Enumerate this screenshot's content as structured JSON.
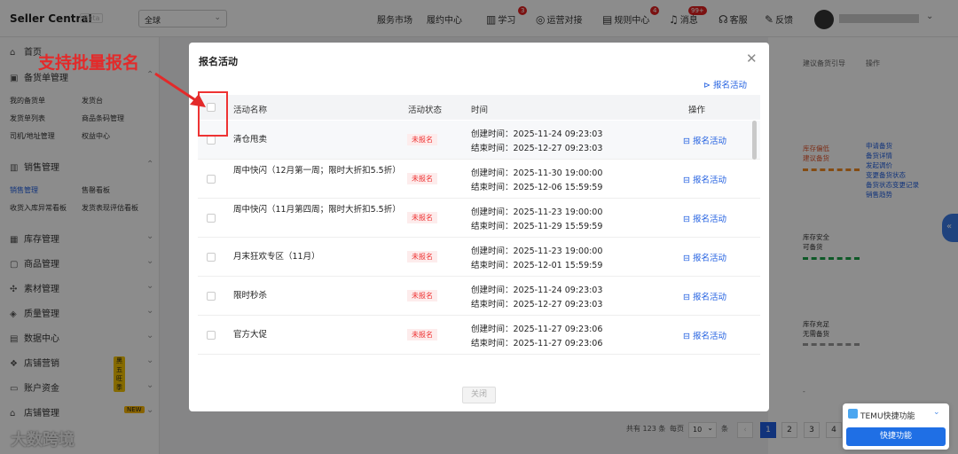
{
  "header": {
    "brand": "Seller Central",
    "beta": "Beta",
    "region": "全球",
    "links": [
      "服务市场",
      "履约中心"
    ],
    "tools": [
      {
        "label": "学习",
        "badge": "3",
        "icon": "book-icon"
      },
      {
        "label": "运营对接",
        "icon": "chat-icon"
      },
      {
        "label": "规则中心",
        "badge": "4",
        "icon": "rules-icon"
      },
      {
        "label": "消息",
        "badge": "99+",
        "icon": "bell-icon"
      },
      {
        "label": "客服",
        "icon": "headset-icon"
      },
      {
        "label": "反馈",
        "icon": "feedback-icon"
      }
    ]
  },
  "sidebar": {
    "home": "首页",
    "g1": "备货单管理",
    "g1_items": [
      "我的备货单",
      "发货台",
      "发货单列表",
      "商品条码管理",
      "司机/地址管理",
      "权益中心"
    ],
    "g2": "销售管理",
    "g2_items": [
      "销售管理",
      "售罄看板",
      "收货入库异常看板",
      "发货表现评估看板"
    ],
    "groups": [
      "库存管理",
      "商品管理",
      "素材管理",
      "质量管理",
      "数据中心",
      "店铺营销",
      "账户资金",
      "店铺管理"
    ],
    "marketing_badge": "黑五旺季",
    "new_badge": "NEW",
    "watermark": "大数跨境"
  },
  "right_panel": {
    "headers": [
      "建议备货引导",
      "操作"
    ],
    "block1": [
      "库存偏低",
      "建议备货"
    ],
    "ops": [
      "申请备货",
      "备货详情",
      "发起调价",
      "变更备货状态",
      "备货状态变更记录",
      "销售趋势"
    ],
    "block2": [
      "库存安全",
      "可备货"
    ],
    "block3": [
      "库存充足",
      "无需备货"
    ],
    "dash": "-"
  },
  "pager": {
    "total": "共有 123 条",
    "per": "每页",
    "size": "10",
    "unit": "条",
    "pages": [
      "1",
      "2",
      "3",
      "4"
    ]
  },
  "quick": {
    "title": "TEMU快捷功能",
    "button": "快捷功能"
  },
  "annotation": "支持批量报名",
  "modal": {
    "title": "报名活动",
    "top_action": "报名活动",
    "columns": [
      "活动名称",
      "活动状态",
      "时间",
      "操作"
    ],
    "rows": [
      {
        "name": "清仓甩卖",
        "status": "未报名",
        "created": "创建时间：2025-11-24 09:23:03",
        "end": "结束时间：2025-12-27 09:23:03",
        "action": "报名活动"
      },
      {
        "name": "周中快闪（12月第一周；限时大折扣5.5折）",
        "status": "未报名",
        "created": "创建时间：2025-11-30 19:00:00",
        "end": "结束时间：2025-12-06 15:59:59",
        "action": "报名活动"
      },
      {
        "name": "周中快闪（11月第四周；限时大折扣5.5折）",
        "status": "未报名",
        "created": "创建时间：2025-11-23 19:00:00",
        "end": "结束时间：2025-11-29 15:59:59",
        "action": "报名活动"
      },
      {
        "name": "月末狂欢专区（11月）",
        "status": "未报名",
        "created": "创建时间：2025-11-23 19:00:00",
        "end": "结束时间：2025-12-01 15:59:59",
        "action": "报名活动"
      },
      {
        "name": "限时秒杀",
        "status": "未报名",
        "created": "创建时间：2025-11-24 09:23:03",
        "end": "结束时间：2025-12-27 09:23:03",
        "action": "报名活动"
      },
      {
        "name": "官方大促",
        "status": "未报名",
        "created": "创建时间：2025-11-27 09:23:06",
        "end": "结束时间：2025-11-27 09:23:06",
        "action": "报名活动"
      }
    ],
    "close": "关闭"
  }
}
